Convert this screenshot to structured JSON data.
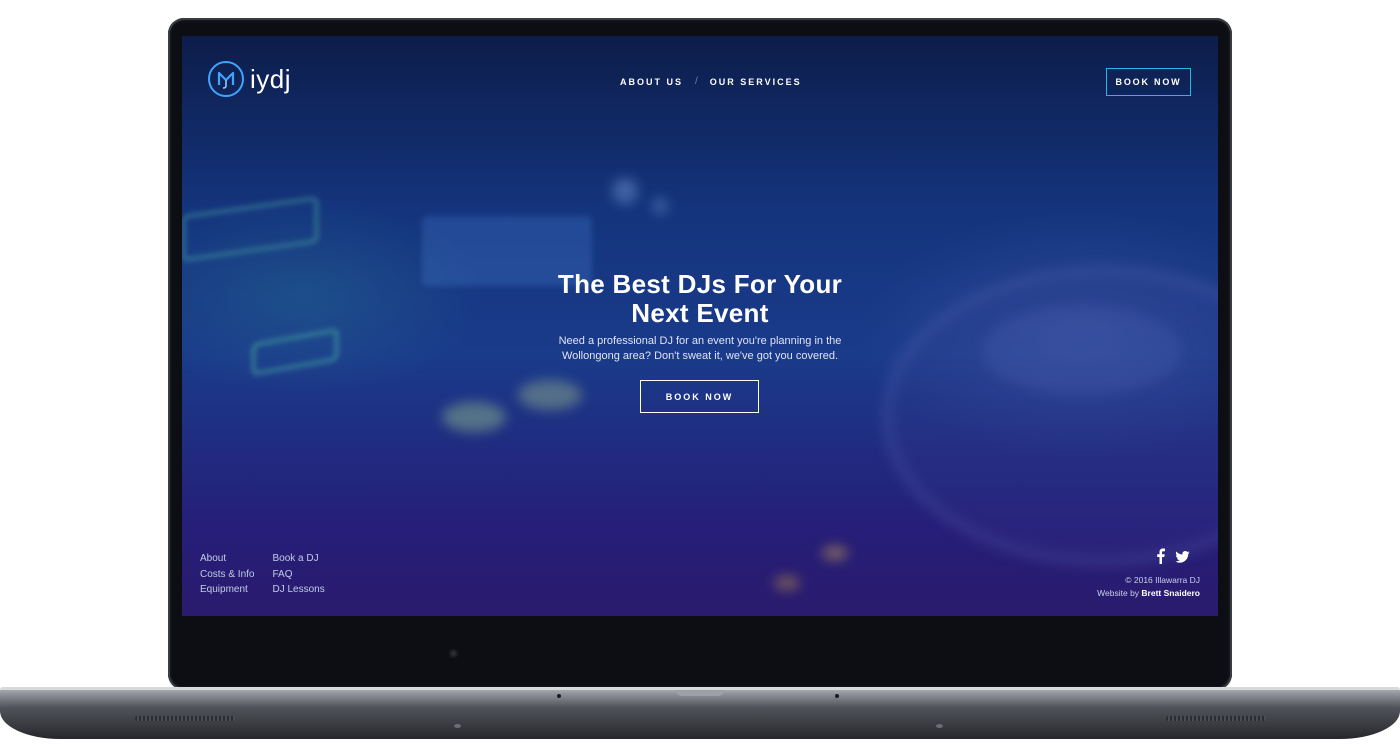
{
  "header": {
    "logo_text": "iydj",
    "nav": [
      {
        "label": "ABOUT US"
      },
      {
        "label": "OUR SERVICES"
      }
    ],
    "nav_separator": "/",
    "book_button": "BOOK NOW"
  },
  "hero": {
    "title_line1": "The Best DJs For Your",
    "title_line2": "Next Event",
    "subtitle": "Need a professional DJ for an event you're planning in the Wollongong area? Don't sweat it, we've got you covered.",
    "book_button": "BOOK NOW"
  },
  "footer": {
    "links_col1": [
      "About",
      "Costs & Info",
      "Equipment"
    ],
    "links_col2": [
      "Book a DJ",
      "FAQ",
      "DJ Lessons"
    ],
    "copyright": "© 2016 Illawarra DJ",
    "credit_prefix": "Website by",
    "credit_name": "Brett Snaidero",
    "social_icons": [
      "facebook-icon",
      "twitter-icon"
    ]
  },
  "colors": {
    "accent": "#27b6e6",
    "logo_ring": "#3da4ff",
    "background_top": "#0d1d4a",
    "background_bottom": "#2a1b6e"
  }
}
